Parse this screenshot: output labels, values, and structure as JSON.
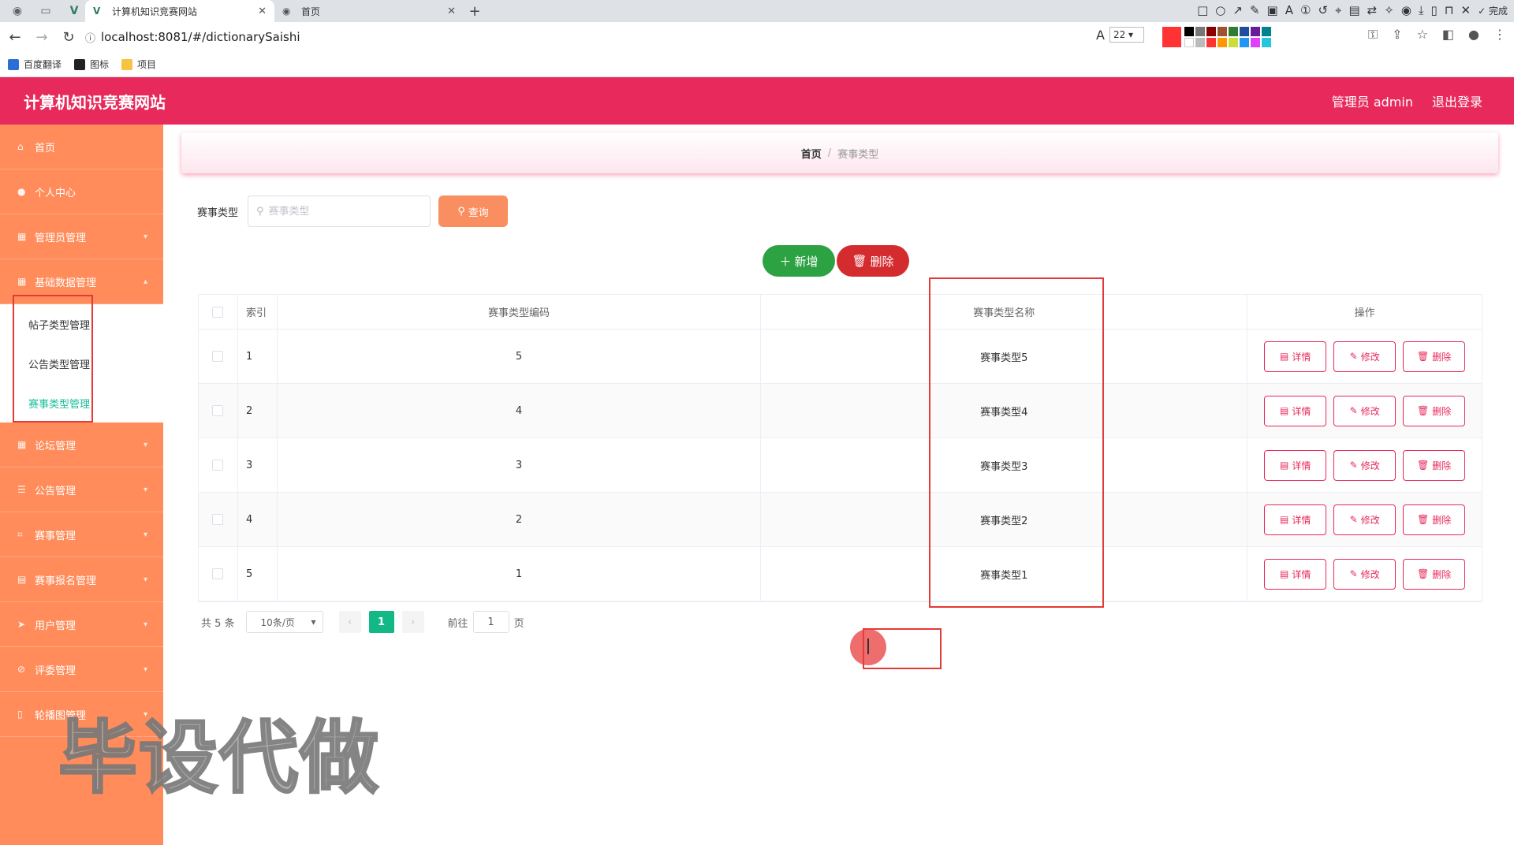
{
  "browser": {
    "tabs": [
      {
        "label": "计算机知识竞赛网站",
        "active": true
      },
      {
        "label": "首页",
        "active": false
      }
    ],
    "url": "localhost:8081/#/dictionarySaishi",
    "font_size": "22",
    "annot_done": "完成",
    "bookmarks": [
      "百度翻译",
      "图标",
      "项目"
    ]
  },
  "app": {
    "title": "计算机知识竞赛网站",
    "user": "管理员 admin",
    "logout": "退出登录"
  },
  "sidebar": {
    "items": [
      {
        "label": "首页",
        "icon": "home-icon"
      },
      {
        "label": "个人中心",
        "icon": "user-icon"
      },
      {
        "label": "管理员管理",
        "icon": "grid-icon"
      },
      {
        "label": "基础数据管理",
        "icon": "grid-icon"
      },
      {
        "label": "论坛管理",
        "icon": "grid-icon"
      },
      {
        "label": "公告管理",
        "icon": "list-icon"
      },
      {
        "label": "赛事管理",
        "icon": "crop-icon"
      },
      {
        "label": "赛事报名管理",
        "icon": "box-icon"
      },
      {
        "label": "用户管理",
        "icon": "send-icon"
      },
      {
        "label": "评委管理",
        "icon": "cancel-icon"
      },
      {
        "label": "轮播图管理",
        "icon": "mic-icon"
      }
    ],
    "submenu": [
      "帖子类型管理",
      "公告类型管理",
      "赛事类型管理"
    ]
  },
  "breadcrumb": {
    "home": "首页",
    "sep": "/",
    "current": "赛事类型"
  },
  "search": {
    "label": "赛事类型",
    "placeholder": "赛事类型",
    "button": "查询"
  },
  "actions": {
    "add": "新增",
    "delete": "删除"
  },
  "table": {
    "headers": [
      "索引",
      "赛事类型编码",
      "赛事类型名称",
      "操作"
    ],
    "rows": [
      {
        "index": "1",
        "code": "5",
        "name": "赛事类型5"
      },
      {
        "index": "2",
        "code": "4",
        "name": "赛事类型4"
      },
      {
        "index": "3",
        "code": "3",
        "name": "赛事类型3"
      },
      {
        "index": "4",
        "code": "2",
        "name": "赛事类型2"
      },
      {
        "index": "5",
        "code": "1",
        "name": "赛事类型1"
      }
    ],
    "ops": {
      "detail": "详情",
      "edit": "修改",
      "delete": "删除"
    }
  },
  "pager": {
    "total": "共 5 条",
    "size": "10条/页",
    "page": "1",
    "goto": "前往",
    "jump": "1",
    "unit": "页"
  },
  "watermark": "毕设代做",
  "colors": {
    "header": "#e8295b",
    "sidebar": "#ff8c5a",
    "accent": "#12b886"
  }
}
